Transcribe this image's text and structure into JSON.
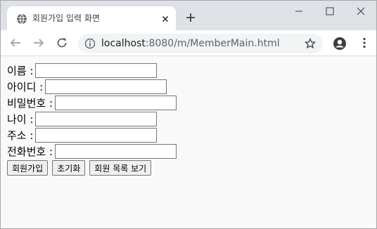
{
  "browser": {
    "tab_title": "회원가입 입력 화면",
    "url_host": "localhost",
    "url_rest": ":8080/m/MemberMain.html"
  },
  "icons": {
    "favicon": "globe-icon",
    "tab_close": "close-icon",
    "new_tab": "plus-icon",
    "minimize": "minimize-icon",
    "maximize": "maximize-icon",
    "close_window": "close-window-icon",
    "back": "back-arrow-icon",
    "forward": "forward-arrow-icon",
    "reload": "reload-icon",
    "site_info": "info-icon",
    "bookmark": "star-icon",
    "profile": "profile-icon",
    "menu": "kebab-menu-icon"
  },
  "form": {
    "fields": [
      {
        "label": "이름 :",
        "value": ""
      },
      {
        "label": "아이디 :",
        "value": ""
      },
      {
        "label": "비밀번호 :",
        "value": ""
      },
      {
        "label": "나이 :",
        "value": ""
      },
      {
        "label": "주소 :",
        "value": ""
      },
      {
        "label": "전화번호 :",
        "value": ""
      }
    ],
    "buttons": {
      "signup": "회원가입",
      "reset": "초기화",
      "list": "회원 목록 보기"
    }
  }
}
